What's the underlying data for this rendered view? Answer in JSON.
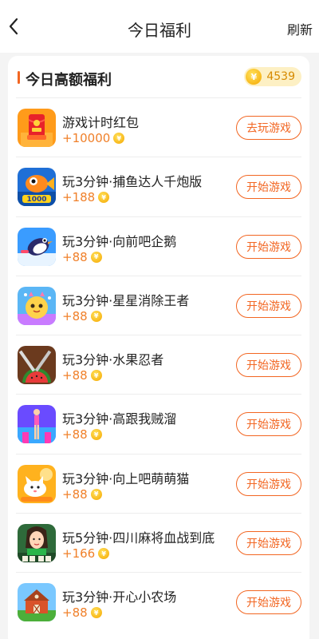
{
  "header": {
    "title": "今日福利",
    "refresh_label": "刷新"
  },
  "section": {
    "title": "今日高额福利",
    "coin_symbol": "¥",
    "coin_balance": "4539"
  },
  "items": [
    {
      "name": "游戏计时红包",
      "reward": "+10000",
      "button": "去玩游戏",
      "icon": "red-packet-icon"
    },
    {
      "name": "玩3分钟·捕鱼达人千炮版",
      "reward": "+188",
      "button": "开始游戏",
      "icon": "fishing-game-icon"
    },
    {
      "name": "玩3分钟·向前吧企鹅",
      "reward": "+88",
      "button": "开始游戏",
      "icon": "penguin-game-icon"
    },
    {
      "name": "玩3分钟·星星消除王者",
      "reward": "+88",
      "button": "开始游戏",
      "icon": "star-match-game-icon"
    },
    {
      "name": "玩3分钟·水果忍者",
      "reward": "+88",
      "button": "开始游戏",
      "icon": "fruit-ninja-game-icon"
    },
    {
      "name": "玩3分钟·高跟我贼溜",
      "reward": "+88",
      "button": "开始游戏",
      "icon": "high-heels-game-icon"
    },
    {
      "name": "玩3分钟·向上吧萌萌猫",
      "reward": "+88",
      "button": "开始游戏",
      "icon": "cute-cat-game-icon"
    },
    {
      "name": "玩5分钟·四川麻将血战到底",
      "reward": "+166",
      "button": "开始游戏",
      "icon": "mahjong-game-icon"
    },
    {
      "name": "玩3分钟·开心小农场",
      "reward": "+88",
      "button": "开始游戏",
      "icon": "farm-game-icon"
    }
  ]
}
